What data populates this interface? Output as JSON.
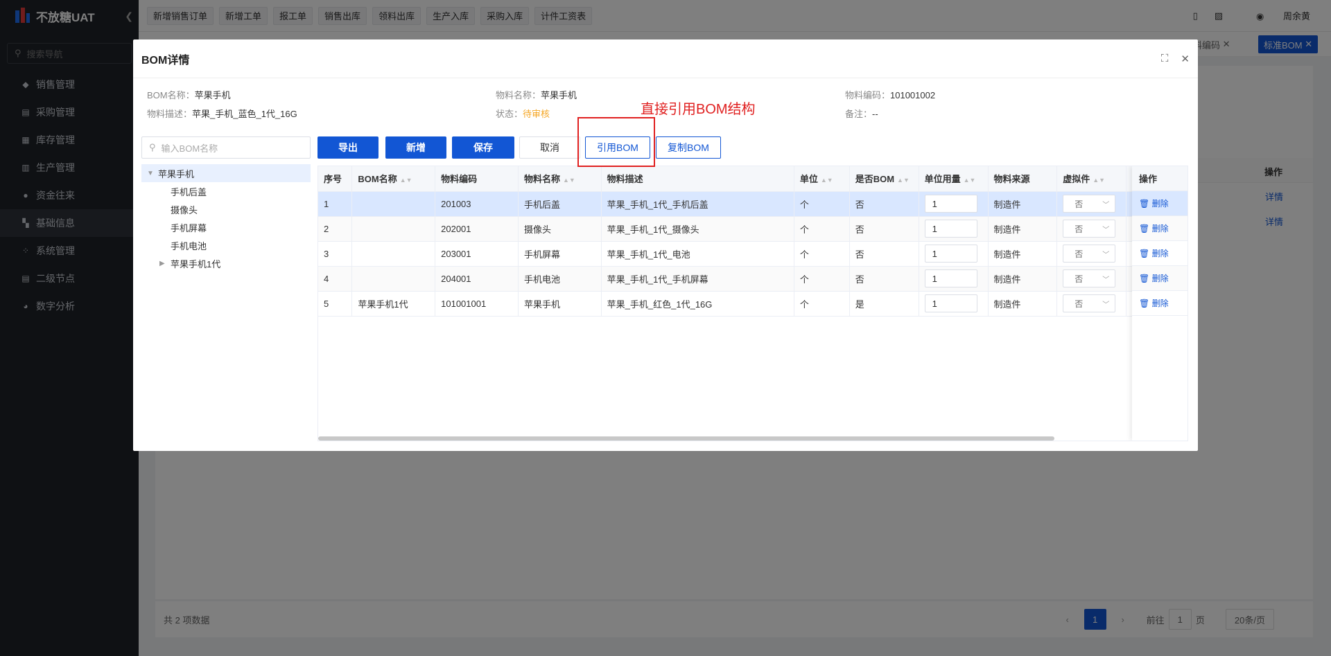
{
  "app": {
    "name": "不放糖UAT"
  },
  "sidebar": {
    "search_placeholder": "搜索导航",
    "items": [
      {
        "label": "销售管理"
      },
      {
        "label": "采购管理"
      },
      {
        "label": "库存管理"
      },
      {
        "label": "生产管理"
      },
      {
        "label": "资金往来"
      },
      {
        "label": "基础信息"
      },
      {
        "label": "系统管理"
      },
      {
        "label": "二级节点"
      },
      {
        "label": "数字分析"
      }
    ]
  },
  "topbar": {
    "quick_actions": [
      "新增销售订单",
      "新增工单",
      "报工单",
      "销售出库",
      "领料出库",
      "生产入库",
      "采购入库",
      "计件工资表"
    ],
    "user": "周余黄"
  },
  "tabs": [
    {
      "label": "物料编码"
    },
    {
      "label": "标准BOM"
    }
  ],
  "background": {
    "op_header": "操作",
    "row_action": "详情",
    "total": "共 2 项数据",
    "pager": {
      "current": "1",
      "goto_label": "前往",
      "goto_value": "1",
      "page_unit": "页",
      "page_size": "20条/页"
    }
  },
  "modal": {
    "title": "BOM详情",
    "info": {
      "bom_name_label": "BOM名称：",
      "bom_name": "苹果手机",
      "material_name_label": "物料名称：",
      "material_name": "苹果手机",
      "material_code_label": "物料编码：",
      "material_code": "101001002",
      "material_desc_label": "物料描述：",
      "material_desc": "苹果_手机_蓝色_1代_16G",
      "status_label": "状态：",
      "status": "待审核",
      "remark_label": "备注：",
      "remark": "--"
    },
    "annotation": "直接引用BOM结构",
    "tree": {
      "placeholder": "输入BOM名称",
      "root": "苹果手机",
      "children": [
        "手机后盖",
        "摄像头",
        "手机屏幕",
        "手机电池",
        "苹果手机1代"
      ]
    },
    "buttons": {
      "export": "导出",
      "add": "新增",
      "save": "保存",
      "cancel": "取消",
      "ref_bom": "引用BOM",
      "copy_bom": "复制BOM"
    },
    "table": {
      "headers": [
        "序号",
        "BOM名称",
        "物料编码",
        "物料名称",
        "物料描述",
        "单位",
        "是否BOM",
        "单位用量",
        "物料来源",
        "虚拟件",
        "操作"
      ],
      "rows": [
        {
          "no": "1",
          "bom_name": "",
          "code": "201003",
          "name": "手机后盖",
          "desc": "苹果_手机_1代_手机后盖",
          "unit": "个",
          "is_bom": "否",
          "qty": "1",
          "source": "制造件",
          "virtual": "否",
          "action": "删除"
        },
        {
          "no": "2",
          "bom_name": "",
          "code": "202001",
          "name": "摄像头",
          "desc": "苹果_手机_1代_摄像头",
          "unit": "个",
          "is_bom": "否",
          "qty": "1",
          "source": "制造件",
          "virtual": "否",
          "action": "删除"
        },
        {
          "no": "3",
          "bom_name": "",
          "code": "203001",
          "name": "手机屏幕",
          "desc": "苹果_手机_1代_电池",
          "unit": "个",
          "is_bom": "否",
          "qty": "1",
          "source": "制造件",
          "virtual": "否",
          "action": "删除"
        },
        {
          "no": "4",
          "bom_name": "",
          "code": "204001",
          "name": "手机电池",
          "desc": "苹果_手机_1代_手机屏幕",
          "unit": "个",
          "is_bom": "否",
          "qty": "1",
          "source": "制造件",
          "virtual": "否",
          "action": "删除"
        },
        {
          "no": "5",
          "bom_name": "苹果手机1代",
          "code": "101001001",
          "name": "苹果手机",
          "desc": "苹果_手机_红色_1代_16G",
          "unit": "个",
          "is_bom": "是",
          "qty": "1",
          "source": "制造件",
          "virtual": "否",
          "action": "删除"
        }
      ]
    }
  },
  "colors": {
    "primary": "#1256d4",
    "pending": "#f5a623",
    "annotation": "#e02020",
    "sidebar_bg": "#1f2329"
  }
}
